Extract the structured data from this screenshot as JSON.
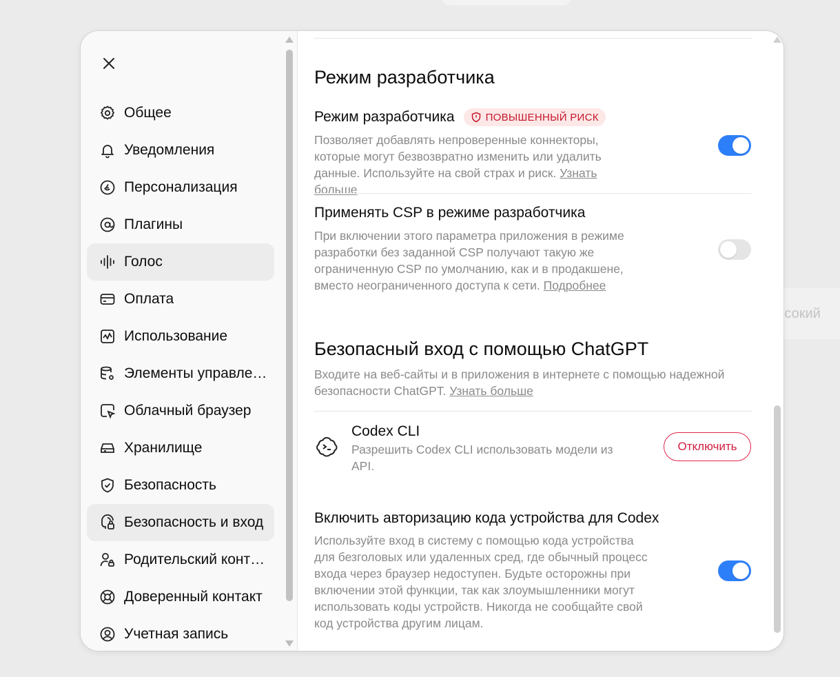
{
  "background": {
    "chip_text": "ысокий"
  },
  "sidebar": {
    "items": [
      {
        "label": "Общее",
        "icon": "gear-icon",
        "active": false
      },
      {
        "label": "Уведомления",
        "icon": "bell-icon",
        "active": false
      },
      {
        "label": "Персонализация",
        "icon": "personalization-icon",
        "active": false
      },
      {
        "label": "Плагины",
        "icon": "plugins-icon",
        "active": false
      },
      {
        "label": "Голос",
        "icon": "voice-waveform-icon",
        "active": true
      },
      {
        "label": "Оплата",
        "icon": "card-icon",
        "active": false
      },
      {
        "label": "Использование",
        "icon": "usage-chart-icon",
        "active": false
      },
      {
        "label": "Элементы управле…",
        "icon": "data-controls-icon",
        "active": false
      },
      {
        "label": "Облачный браузер",
        "icon": "cloud-browser-icon",
        "active": false
      },
      {
        "label": "Хранилище",
        "icon": "storage-icon",
        "active": false
      },
      {
        "label": "Безопасность",
        "icon": "shield-check-icon",
        "active": false
      },
      {
        "label": "Безопасность и вход",
        "icon": "security-login-icon",
        "active": true
      },
      {
        "label": "Родительский конт…",
        "icon": "parental-control-icon",
        "active": false
      },
      {
        "label": "Доверенный контакт",
        "icon": "lifebuoy-icon",
        "active": false
      },
      {
        "label": "Учетная запись",
        "icon": "account-icon",
        "active": false
      }
    ]
  },
  "content": {
    "dev_section_title": "Режим разработчика",
    "dev_mode": {
      "title": "Режим разработчика",
      "badge": "ПОВЫШЕННЫЙ РИСК",
      "desc": "Позволяет добавлять непроверенные коннекторы, которые могут безвозвратно изменить или удалить данные. Используйте на свой страх и риск.",
      "link": "Узнать больше",
      "enabled": true
    },
    "csp": {
      "title": "Применять CSP в режиме разработчика",
      "desc": "При включении этого параметра приложения в режиме разработки без заданной CSP получают такую же ограниченную CSP по умолчанию, как и в продакшене, вместо неограниченного доступа к сети.",
      "link": "Подробнее",
      "enabled": false
    },
    "secure_login": {
      "title": "Безопасный вход с помощью ChatGPT",
      "desc": "Входите на веб-сайты и в приложения в интернете с помощью надежной безопасности ChatGPT.",
      "link": "Узнать больше"
    },
    "codex": {
      "name": "Codex CLI",
      "desc": "Разрешить Codex CLI использовать модели из API.",
      "button": "Отключить"
    },
    "device_auth": {
      "title": "Включить авторизацию кода устройства для Codex",
      "desc": "Используйте вход в систему с помощью кода устройства для безголовых или удаленных сред, где обычный процесс входа через браузер недоступен. Будьте осторожны при включении этой функции, так как злоумышленники могут использовать коды устройств. Никогда не сообщайте свой код устройства другим лицам.",
      "enabled": true
    }
  },
  "colors": {
    "accent": "#2d7ff9",
    "danger": "#d11d3f",
    "badge_bg": "#fde8e8"
  }
}
